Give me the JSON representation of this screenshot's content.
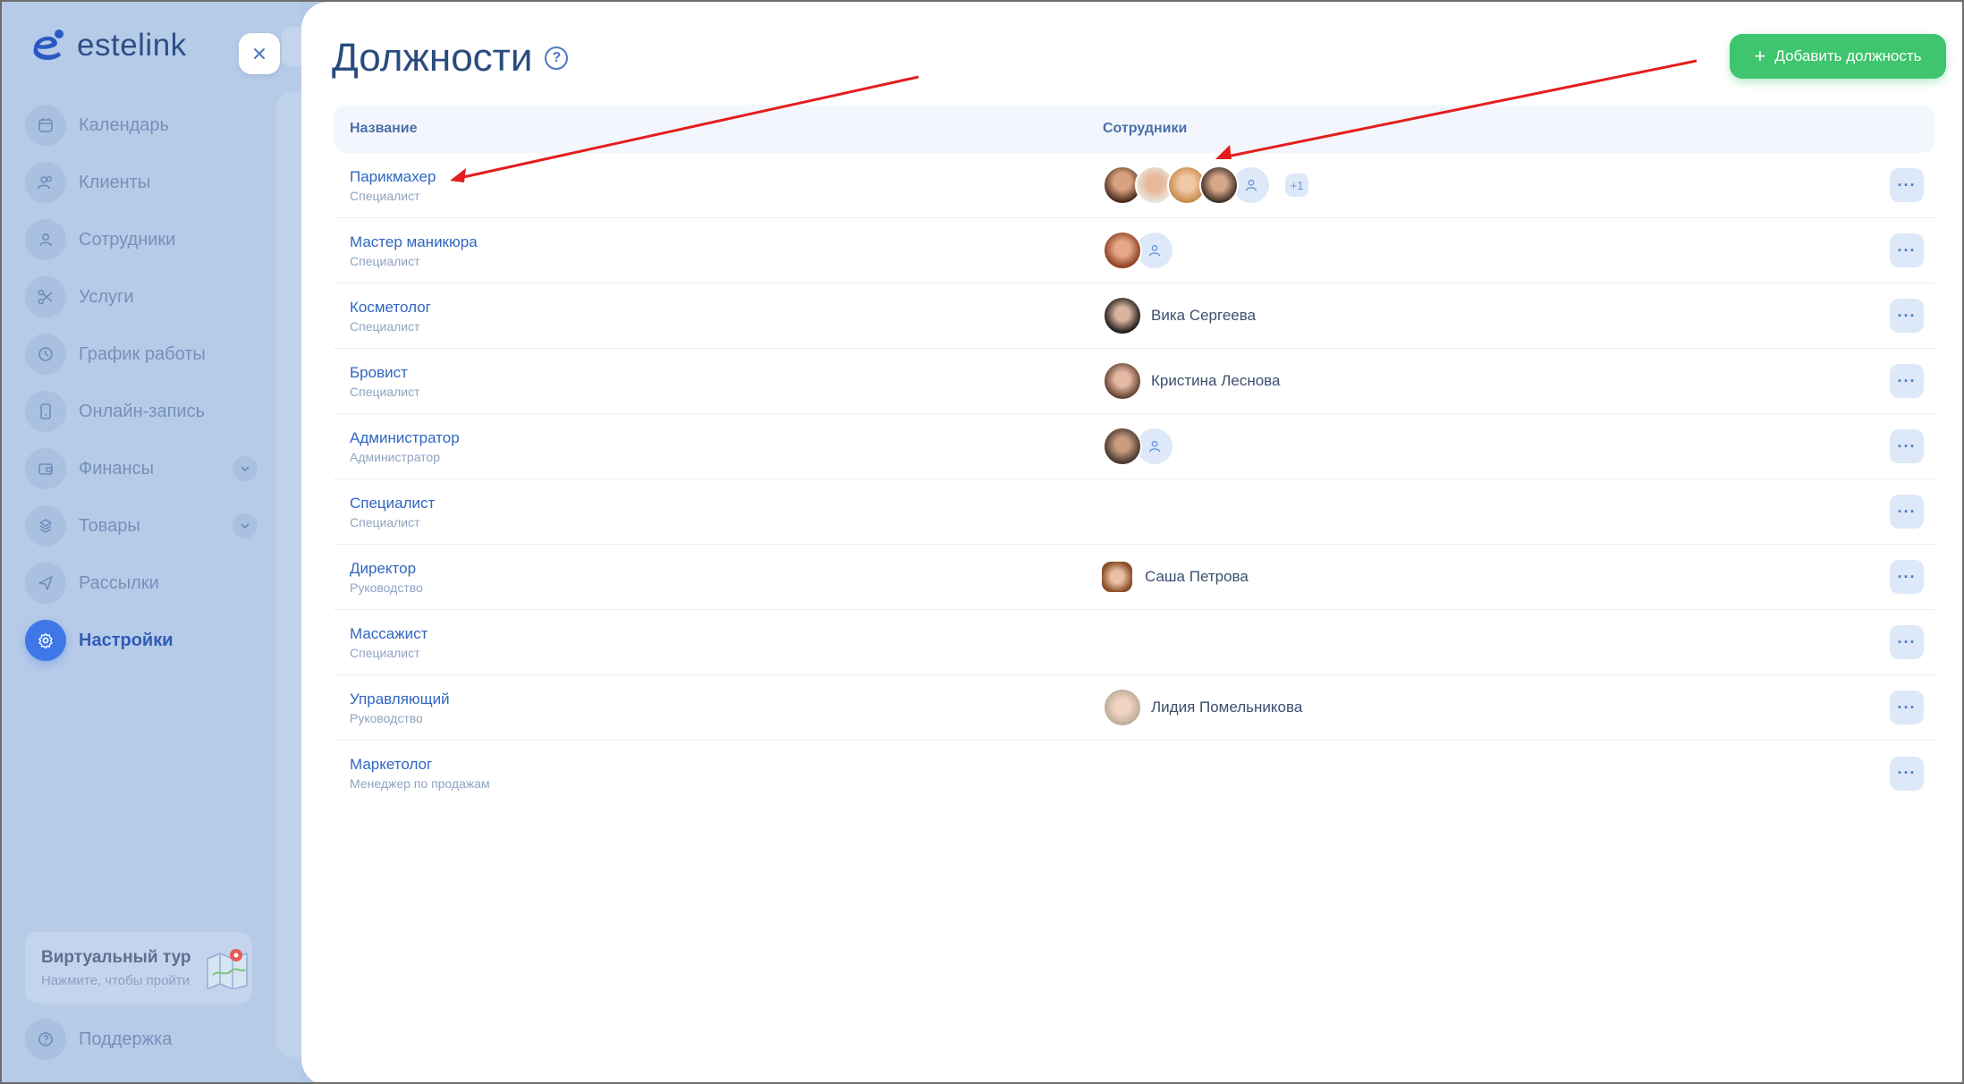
{
  "app": {
    "logo_text": "estelink"
  },
  "sidebar": {
    "items": [
      {
        "label": "Календарь",
        "icon": "calendar-icon"
      },
      {
        "label": "Клиенты",
        "icon": "clients-icon"
      },
      {
        "label": "Сотрудники",
        "icon": "user-icon"
      },
      {
        "label": "Услуги",
        "icon": "scissors-icon"
      },
      {
        "label": "График работы",
        "icon": "clock-icon"
      },
      {
        "label": "Онлайн-запись",
        "icon": "phone-icon"
      },
      {
        "label": "Финансы",
        "icon": "wallet-icon",
        "expandable": true
      },
      {
        "label": "Товары",
        "icon": "box-icon",
        "expandable": true
      },
      {
        "label": "Рассылки",
        "icon": "send-icon"
      },
      {
        "label": "Настройки",
        "icon": "gear-icon",
        "active": true
      }
    ],
    "tour": {
      "title": "Виртуальный тур",
      "subtitle": "Нажмите, чтобы пройти"
    },
    "support_label": "Поддержка"
  },
  "page": {
    "title": "Должности",
    "add_button": "Добавить должность",
    "columns": {
      "name": "Название",
      "staff": "Сотрудники"
    }
  },
  "rows": [
    {
      "title": "Парикмахер",
      "subtitle": "Специалист",
      "staff_name": "",
      "extra": "+1"
    },
    {
      "title": "Мастер маникюра",
      "subtitle": "Специалист",
      "staff_name": ""
    },
    {
      "title": "Косметолог",
      "subtitle": "Специалист",
      "staff_name": "Вика Сергеева"
    },
    {
      "title": "Бровист",
      "subtitle": "Специалист",
      "staff_name": "Кристина Леснова"
    },
    {
      "title": "Администратор",
      "subtitle": "Администратор",
      "staff_name": ""
    },
    {
      "title": "Специалист",
      "subtitle": "Специалист",
      "staff_name": ""
    },
    {
      "title": "Директор",
      "subtitle": "Руководство",
      "staff_name": "Саша Петрова"
    },
    {
      "title": "Массажист",
      "subtitle": "Специалист",
      "staff_name": ""
    },
    {
      "title": "Управляющий",
      "subtitle": "Руководство",
      "staff_name": "Лидия Помельникова"
    },
    {
      "title": "Маркетолог",
      "subtitle": "Менеджер по продажам",
      "staff_name": ""
    }
  ],
  "colors": {
    "accent": "#3f78e6",
    "add_button": "#3ec56d",
    "annotation_arrow": "#e41e1e"
  }
}
